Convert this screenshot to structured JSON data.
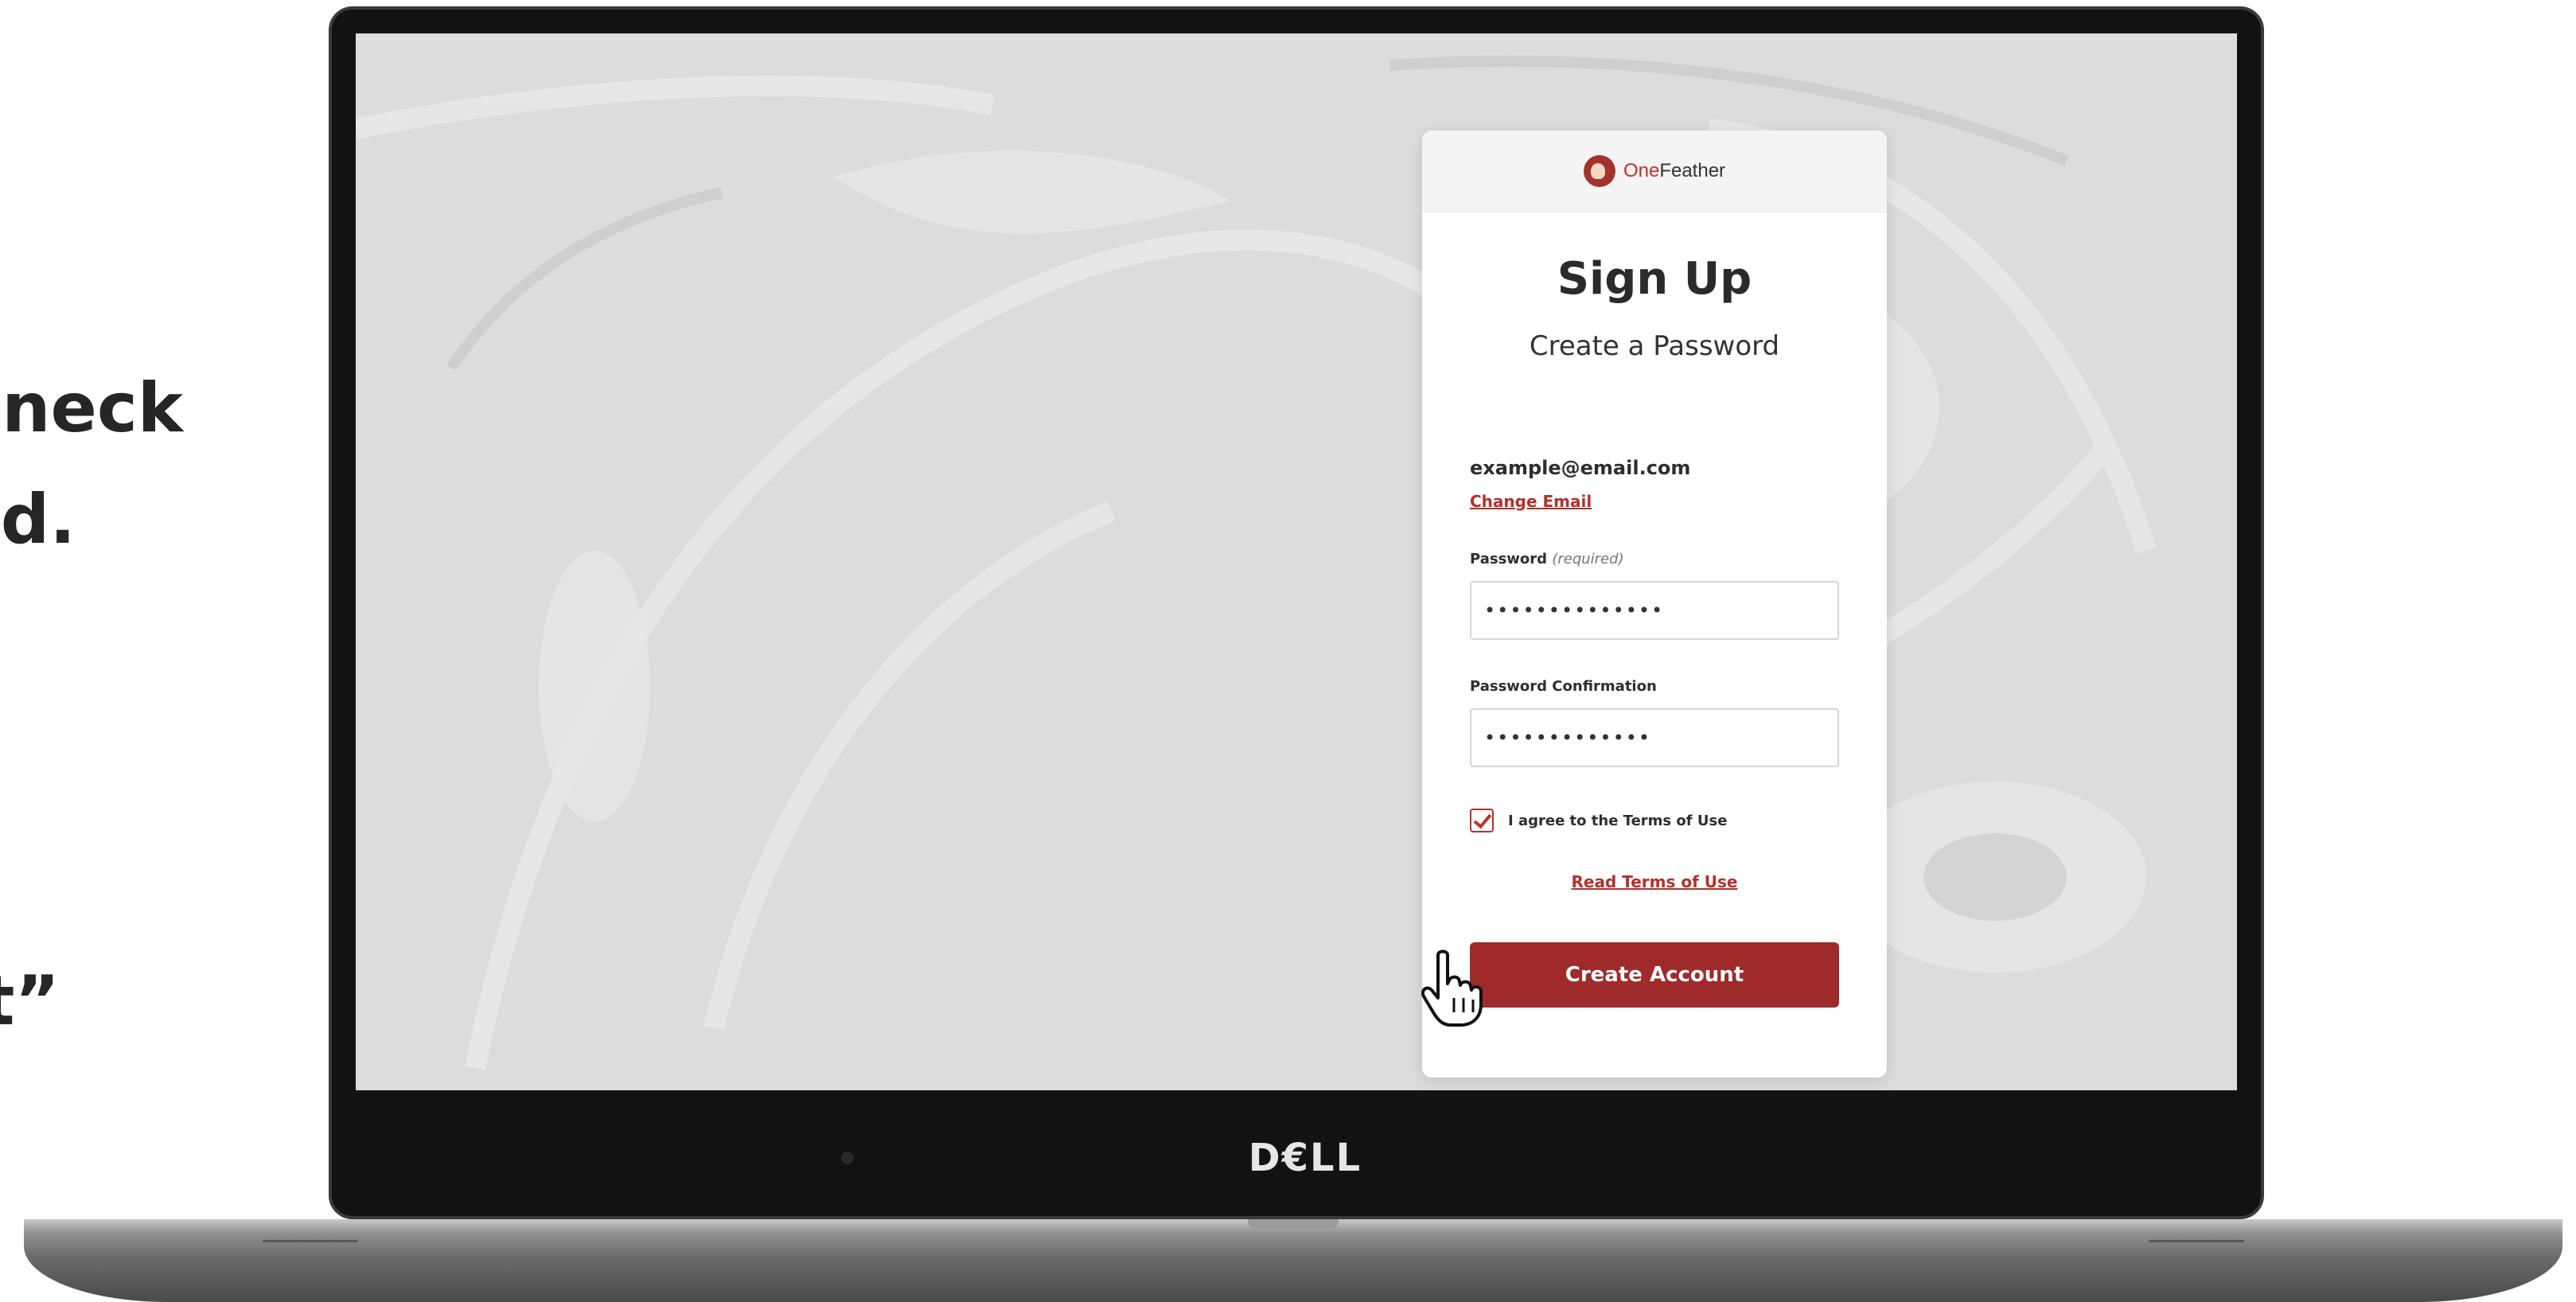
{
  "instruction": {
    "line1": "neck",
    "line2": "d.",
    "line3": "nt”"
  },
  "device": {
    "brand": "D€LL"
  },
  "card": {
    "logo": {
      "one": "One",
      "feather": "Feather"
    },
    "title": "Sign Up",
    "subtitle": "Create a Password",
    "email": "example@email.com",
    "change_email": "Change Email",
    "password_label": "Password",
    "password_required": "(required)",
    "password_value": "••••••••••••••",
    "confirm_label": "Password Confirmation",
    "confirm_value": "•••••••••••••",
    "agree_label": "I agree to the Terms of Use",
    "terms_link": "Read Terms of Use",
    "create_button": "Create Account"
  },
  "colors": {
    "accent": "#9e2a2a",
    "link": "#b3312c",
    "screen_bg": "#dedede"
  }
}
